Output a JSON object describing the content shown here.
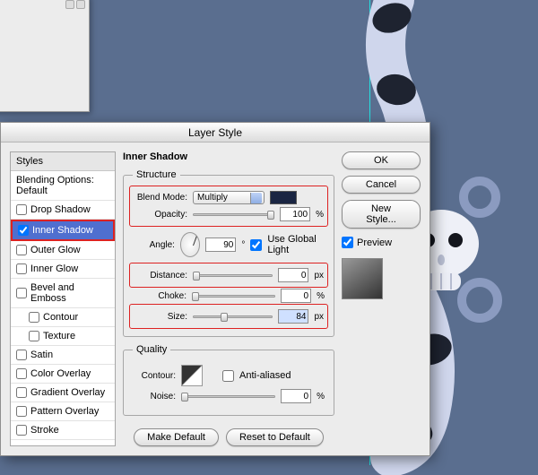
{
  "dialog": {
    "title": "Layer Style",
    "styles_header": "Styles",
    "blending_options": "Blending Options: Default",
    "effects": {
      "drop_shadow": "Drop Shadow",
      "inner_shadow": "Inner Shadow",
      "outer_glow": "Outer Glow",
      "inner_glow": "Inner Glow",
      "bevel_emboss": "Bevel and Emboss",
      "contour": "Contour",
      "texture": "Texture",
      "satin": "Satin",
      "color_overlay": "Color Overlay",
      "gradient_overlay": "Gradient Overlay",
      "pattern_overlay": "Pattern Overlay",
      "stroke": "Stroke"
    },
    "panel_title": "Inner Shadow",
    "structure": {
      "legend": "Structure",
      "blend_mode_label": "Blend Mode:",
      "blend_mode_value": "Multiply",
      "opacity_label": "Opacity:",
      "opacity_value": "100",
      "opacity_unit": "%",
      "angle_label": "Angle:",
      "angle_value": "90",
      "angle_unit": "°",
      "global_light": "Use Global Light",
      "distance_label": "Distance:",
      "distance_value": "0",
      "distance_unit": "px",
      "choke_label": "Choke:",
      "choke_value": "0",
      "choke_unit": "%",
      "size_label": "Size:",
      "size_value": "84",
      "size_unit": "px"
    },
    "quality": {
      "legend": "Quality",
      "contour_label": "Contour:",
      "anti_aliased": "Anti-aliased",
      "noise_label": "Noise:",
      "noise_value": "0",
      "noise_unit": "%"
    },
    "buttons": {
      "make_default": "Make Default",
      "reset_default": "Reset to Default",
      "ok": "OK",
      "cancel": "Cancel",
      "new_style": "New Style...",
      "preview": "Preview"
    }
  }
}
